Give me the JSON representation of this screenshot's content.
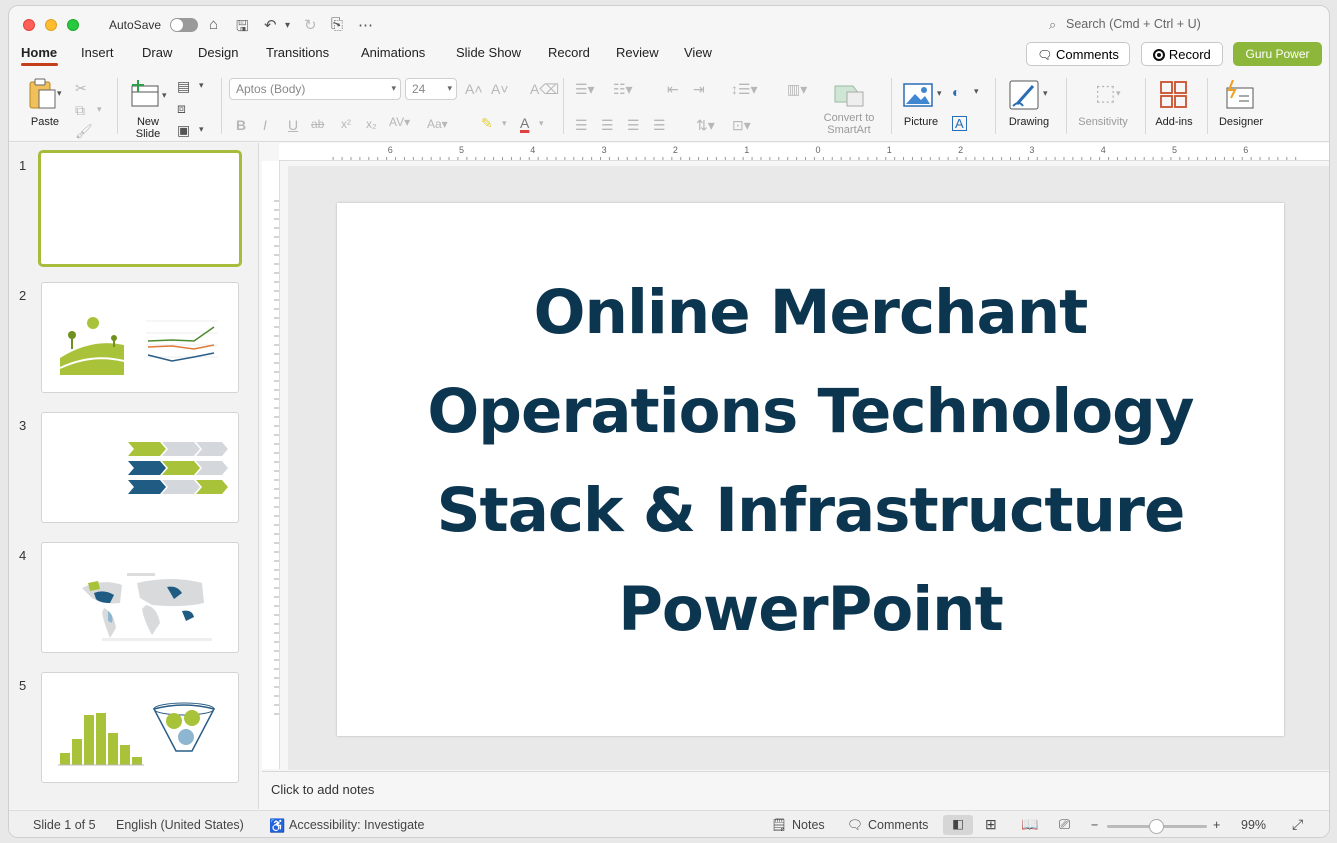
{
  "titlebar": {
    "autosave_label": "AutoSave",
    "search_placeholder": "Search (Cmd + Ctrl + U)"
  },
  "tabs": [
    "Home",
    "Insert",
    "Draw",
    "Design",
    "Transitions",
    "Animations",
    "Slide Show",
    "Record",
    "Review",
    "View"
  ],
  "header_buttons": {
    "comments": "Comments",
    "record": "Record",
    "guru": "Guru Power"
  },
  "ribbon": {
    "paste": "Paste",
    "new_slide_1": "New",
    "new_slide_2": "Slide",
    "font_name": "Aptos (Body)",
    "font_size": "24",
    "convert_1": "Convert to",
    "convert_2": "SmartArt",
    "picture": "Picture",
    "drawing": "Drawing",
    "sensitivity": "Sensitivity",
    "addins": "Add-ins",
    "designer": "Designer"
  },
  "slides": [
    {
      "number": "1"
    },
    {
      "number": "2"
    },
    {
      "number": "3"
    },
    {
      "number": "4"
    },
    {
      "number": "5"
    }
  ],
  "slide_title": {
    "line1": "Online Merchant",
    "line2": "Operations Technology",
    "line3": "Stack & Infrastructure",
    "line4": "PowerPoint"
  },
  "ruler_h_labels": [
    "6",
    "5",
    "4",
    "3",
    "2",
    "1",
    "0",
    "1",
    "2",
    "3",
    "4",
    "5",
    "6"
  ],
  "notes_placeholder": "Click to add notes",
  "status": {
    "slide_info": "Slide 1 of 5",
    "language": "English (United States)",
    "accessibility": "Accessibility: Investigate",
    "notes": "Notes",
    "comments": "Comments",
    "zoom": "99%"
  },
  "colors": {
    "accent": "#c43e1c",
    "guru": "#8db73a",
    "title": "#0c3550",
    "selected_thumb": "#a8bc3c"
  }
}
